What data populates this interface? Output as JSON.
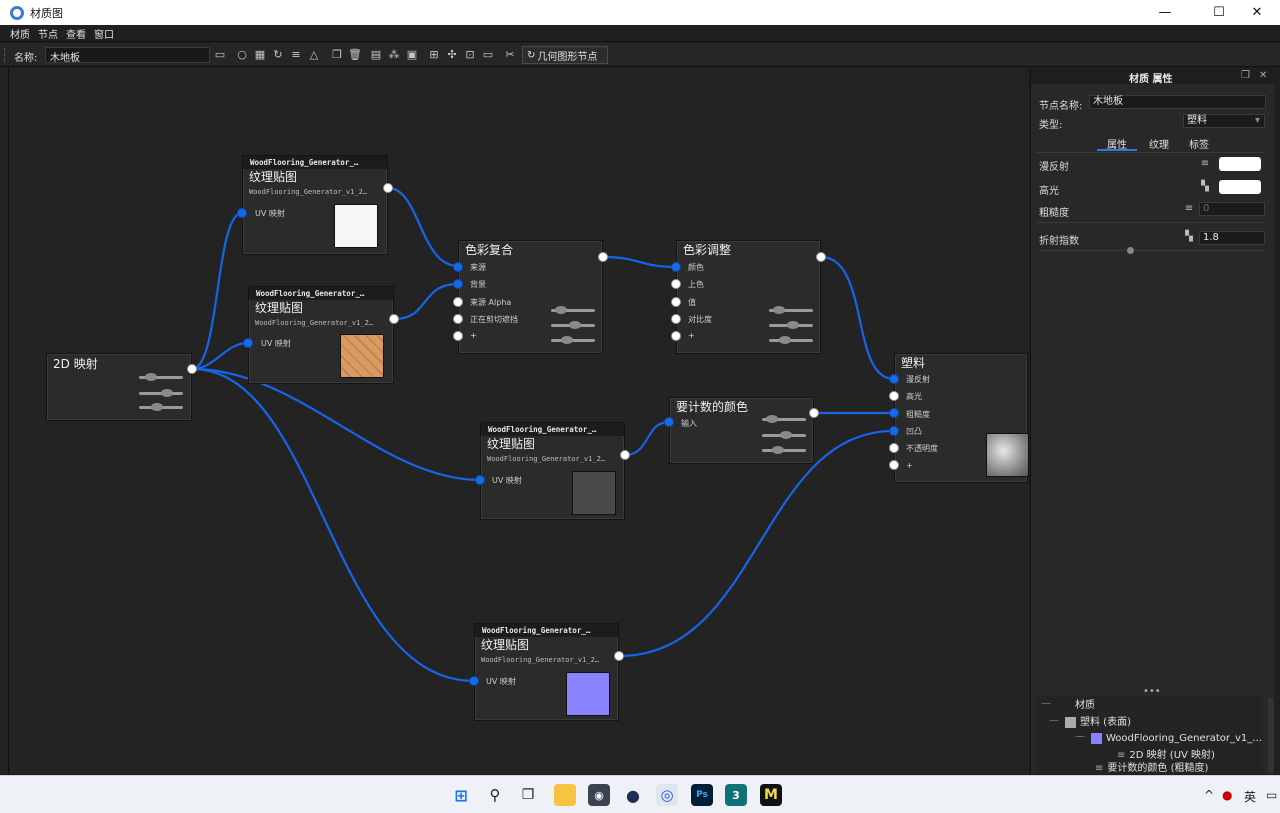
{
  "window": {
    "title": "材质图"
  },
  "menu": [
    "材质",
    "节点",
    "查看",
    "窗口"
  ],
  "toolbar": {
    "name_label": "名称:",
    "name_value": "木地板",
    "geometry_button": "几何图形节点",
    "icons": [
      "save-icon",
      "sphere-icon",
      "grid-icon",
      "refresh-icon",
      "sliders-icon",
      "lock-icon",
      "copy-icon",
      "delete-icon",
      "layout-icon",
      "group-icon",
      "nodes-icon",
      "align-icon",
      "frame-icon",
      "fit-icon",
      "image-icon",
      "scissors-icon"
    ]
  },
  "nodes": {
    "map2d": {
      "title": "2D 映射"
    },
    "tex1": {
      "header": "WoodFlooring_Generator_…",
      "title": "纹理贴图",
      "sub": "WoodFlooring_Generator_v1_2…",
      "port_in": "UV 映射",
      "thumb_color": "#f6f6f6"
    },
    "tex2": {
      "header": "WoodFlooring_Generator_…",
      "title": "纹理贴图",
      "sub": "WoodFlooring_Generator_v1_2…",
      "port_in": "UV 映射",
      "thumb_color": "#d79a63"
    },
    "tex3": {
      "header": "WoodFlooring_Generator_…",
      "title": "纹理贴图",
      "sub": "WoodFlooring_Generator_v1_2…",
      "port_in": "UV 映射",
      "thumb_color": "#4a4a4a"
    },
    "tex4": {
      "header": "WoodFlooring_Generator_…",
      "title": "纹理贴图",
      "sub": "WoodFlooring_Generator_v1_2…",
      "port_in": "UV 映射",
      "thumb_color": "#8882ff"
    },
    "composite": {
      "title": "色彩复合",
      "ports": [
        "来源",
        "背景",
        "来源 Alpha",
        "正在剪切遮挡",
        "+"
      ]
    },
    "adjust": {
      "title": "色彩调整",
      "ports": [
        "颜色",
        "上色",
        "值",
        "对比度",
        "+"
      ]
    },
    "calc": {
      "title": "要计数的颜色",
      "ports": [
        "输入"
      ]
    },
    "plastic": {
      "title": "塑料",
      "ports": [
        "漫反射",
        "高光",
        "粗糙度",
        "凹凸",
        "不透明度",
        "+"
      ]
    }
  },
  "panel": {
    "title": "材质 属性",
    "node_name_label": "节点名称:",
    "node_name_value": "木地板",
    "type_label": "类型:",
    "type_value": "塑料",
    "tabs": [
      "属性",
      "纹理",
      "标签"
    ],
    "props": [
      {
        "label": "漫反射"
      },
      {
        "label": "高光"
      },
      {
        "label": "粗糙度",
        "value": "0"
      },
      {
        "label": "折射指数",
        "value": "1.8"
      }
    ],
    "tree": [
      {
        "label": "材质"
      },
      {
        "label": "塑料 (表面)"
      },
      {
        "label": "WoodFlooring_Generator_v1_…"
      },
      {
        "label": "2D 映射 (UV 映射)"
      },
      {
        "label": "要计数的颜色 (粗糙度)"
      }
    ]
  },
  "taskbar": {
    "apps": [
      "windows-start",
      "search",
      "task-view",
      "file-explorer",
      "app-disk",
      "cinema4d",
      "materials-app",
      "photoshop",
      "3dsmax",
      "maya"
    ],
    "ime": "英"
  },
  "colors": {
    "wire": "#1565e8",
    "port_blue": "#1769e6",
    "accent": "#2a7be8"
  }
}
